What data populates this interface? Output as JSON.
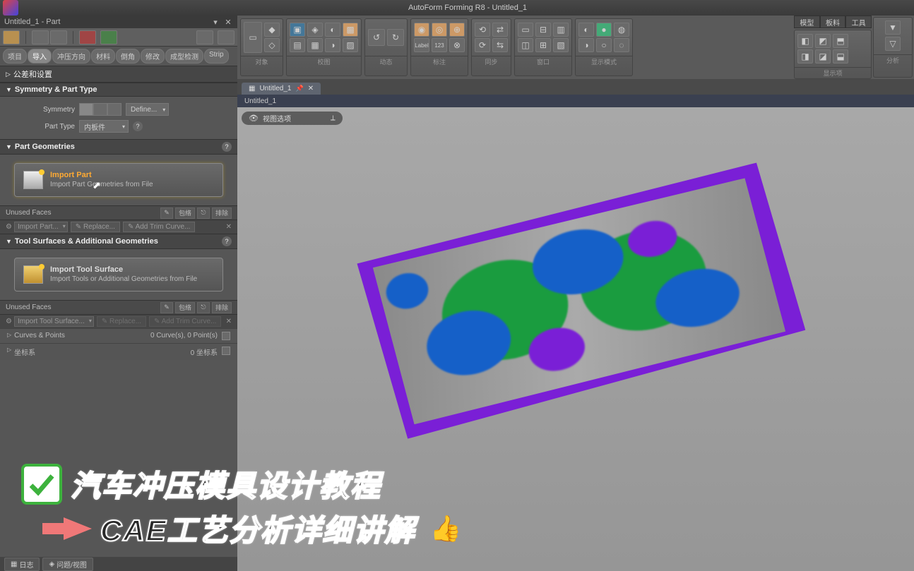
{
  "app": {
    "title": "AutoForm Forming R8 - Untitled_1"
  },
  "panel": {
    "title": "Untitled_1 - Part",
    "tabs": [
      "项目",
      "导入",
      "冲压方向",
      "材料",
      "倒角",
      "修改",
      "成型检测",
      "Strip"
    ],
    "active_tab_index": 1,
    "collapsed_section": "公差和设置",
    "symmetry_section": {
      "title": "Symmetry & Part Type",
      "symmetry_label": "Symmetry",
      "define_label": "Define...",
      "parttype_label": "Part Type",
      "parttype_value": "内板件"
    },
    "part_geom": {
      "title": "Part Geometries",
      "import_title": "Import Part",
      "import_sub": "Import Part Geometries from File",
      "unused_faces": "Unused Faces",
      "baoluo": "包络",
      "paichu": "排除",
      "import_dd": "Import Part...",
      "replace": "Replace...",
      "add_trim": "Add Trim Curve..."
    },
    "tool_surf": {
      "title": "Tool Surfaces & Additional Geometries",
      "import_title": "Import Tool Surface",
      "import_sub": "Import Tools or Additional Geometries from File",
      "unused_faces": "Unused Faces",
      "import_dd": "Import Tool Surface...",
      "replace": "Replace...",
      "add_trim": "Add Trim Curve..."
    },
    "curves_points": {
      "label": "Curves & Points",
      "value": "0 Curve(s), 0 Point(s)"
    },
    "coord": {
      "label": "坐标系",
      "value": "0 坐标系"
    }
  },
  "ribbon": {
    "groups": [
      "对象",
      "校图",
      "动态",
      "标注",
      "同步",
      "窗口",
      "显示模式",
      "显示项",
      "分析"
    ],
    "right_tabs": [
      "模型",
      "板料",
      "工具"
    ]
  },
  "doc": {
    "tab_label": "Untitled_1",
    "subtitle": "Untitled_1"
  },
  "viewport": {
    "chip": "视图选项"
  },
  "overlay": {
    "line1": "汽车冲压模具设计教程",
    "line2": "CAE工艺分析详细讲解"
  },
  "statusbar": {
    "log": "日志",
    "issues": "问题/视图"
  }
}
